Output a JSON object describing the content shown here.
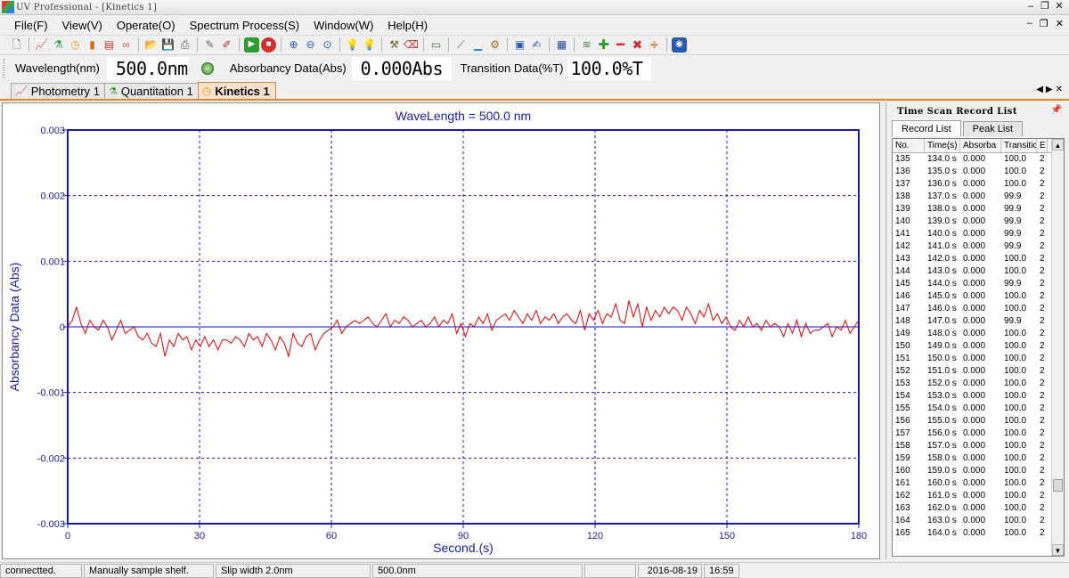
{
  "window": {
    "title": "UV Professional - [Kinetics 1]"
  },
  "menu": [
    "File(F)",
    "View(V)",
    "Operate(O)",
    "Spectrum Process(S)",
    "Window(W)",
    "Help(H)"
  ],
  "toolbar_icons": [
    "new-icon",
    "spectrum-icon",
    "flask-icon",
    "clock-icon",
    "tube-icon",
    "bar-chart-icon",
    "link-icon",
    "open-folder-icon",
    "save-icon",
    "print-icon",
    "pen-icon",
    "eraser-icon",
    "start-icon",
    "stop-icon",
    "zoom-in-icon",
    "zoom-out-icon",
    "zoom-reset-icon",
    "lamp-on-icon",
    "lamp-off-icon",
    "tools-icon",
    "delete-record-icon",
    "window-icon",
    "axis-icon",
    "baseline-icon",
    "settings-icon",
    "scan-window-icon",
    "edit-icon",
    "grid-icon",
    "layers-icon",
    "add-icon",
    "minus-icon",
    "multiply-icon",
    "divide-icon",
    "circle-icon"
  ],
  "readout": {
    "wavelength_label": "Wavelength(nm)",
    "wavelength_value": "500.0nm",
    "absorbance_label": "Absorbancy Data(Abs)",
    "absorbance_value": "0.000Abs",
    "transition_label": "Transition Data(%T)",
    "transition_value": "100.0%T"
  },
  "doc_tabs": [
    {
      "label": "Photometry 1",
      "icon": "spectrum-icon",
      "active": false
    },
    {
      "label": "Quantitation 1",
      "icon": "flask-icon",
      "active": false
    },
    {
      "label": "Kinetics 1",
      "icon": "clock-icon",
      "active": true
    }
  ],
  "chart_data": {
    "type": "line",
    "title": "WaveLength = 500.0 nm",
    "xlabel": "Second.(s)",
    "ylabel": "Absorbancy Data (Abs)",
    "xlim": [
      0,
      180
    ],
    "ylim": [
      -0.003,
      0.003
    ],
    "xticks": [
      0,
      30,
      60,
      90,
      120,
      150,
      180
    ],
    "yticks": [
      0.003,
      0.002,
      0.001,
      0,
      -0.001,
      -0.002,
      -0.003
    ],
    "ytick_labels": [
      "0.003",
      "0.002",
      "0.001",
      "0",
      "-0.001",
      "-0.002",
      "-0.003"
    ],
    "grid": true,
    "colors": {
      "axis": "#1a1aa8",
      "line": "#e00000",
      "zero": "#3a3ad0"
    },
    "series": [
      {
        "values": [
          0.0,
          0.0001,
          0.0003,
          5e-05,
          -0.0001,
          0.0001,
          0.0,
          -5e-05,
          0.0001,
          0.0,
          -0.0002,
          -5e-05,
          0.0001,
          -0.0001,
          -5e-05,
          0.0,
          -0.00015,
          -0.0002,
          -0.0001,
          -0.00025,
          -0.0003,
          -0.0001,
          -0.00045,
          -0.0002,
          -0.0003,
          -0.0001,
          -0.0002,
          -0.00015,
          -0.00035,
          -0.0002,
          -0.0003,
          -0.00015,
          -0.0003,
          -0.0002,
          -0.00035,
          -0.0002,
          -0.0002,
          -0.00025,
          -0.00015,
          -0.0002,
          -0.0003,
          -0.0001,
          -0.0002,
          -0.00015,
          -0.0003,
          -0.0001,
          -0.0002,
          -0.00035,
          -0.00015,
          -0.00025,
          -0.00045,
          -0.0001,
          -0.00025,
          -0.0003,
          -0.00015,
          -0.0001,
          -0.00035,
          -0.0002,
          -0.0001,
          -5e-05,
          0.0,
          0.0001,
          -0.0001,
          0.0,
          5e-05,
          0.0001,
          5e-05,
          0.0001,
          0.00015,
          5e-05,
          0.0,
          0.0001,
          0.0002,
          0.0,
          0.0001,
          5e-05,
          0.00015,
          0.0001,
          0.0,
          5e-05,
          0.0001,
          0.0,
          5e-05,
          0.00015,
          0.0,
          0.0001,
          5e-05,
          0.0002,
          -0.0001,
          5e-05,
          -0.00015,
          5e-05,
          0.0,
          0.00015,
          5e-05,
          0.0002,
          -5e-05,
          0.0001,
          0.00015,
          0.0002,
          0.0001,
          0.00025,
          0.00015,
          5e-05,
          0.0002,
          0.0001,
          0.00025,
          5e-05,
          0.00015,
          0.0001,
          0.0002,
          5e-05,
          0.00015,
          0.0002,
          0.0001,
          5e-05,
          0.00025,
          -5e-05,
          0.0002,
          0.0001,
          0.00025,
          5e-05,
          0.0002,
          0.00015,
          0.00035,
          0.0001,
          5e-05,
          0.0004,
          0.00015,
          0.00035,
          0.0,
          0.0003,
          0.0001,
          0.00025,
          0.00015,
          0.0003,
          0.0002,
          0.0003,
          0.00025,
          0.0001,
          0.0003,
          0.0002,
          5e-05,
          0.00025,
          0.00015,
          0.00035,
          0.0001,
          0.0002,
          5e-05,
          0.00015,
          0.0,
          -5e-05,
          0.0001,
          0.0,
          0.00015,
          0.0,
          5e-05,
          -5e-05,
          0.0001,
          0.0,
          5e-05,
          0.0,
          -0.00015,
          5e-05,
          -0.0001,
          0.0001,
          -0.00015,
          5e-05,
          -0.0001,
          -5e-05,
          -5e-05,
          0.0,
          5e-05,
          -0.00015,
          0.0,
          -5e-05,
          0.0001,
          -0.0001,
          0.0,
          0.0001
        ]
      }
    ]
  },
  "right_panel": {
    "title": "Time Scan Record List",
    "tabs": [
      "Record List",
      "Peak List"
    ],
    "columns": [
      "No.",
      "Time(s)",
      "Absorba",
      "Transitic",
      "E"
    ],
    "rows": [
      [
        "135",
        "134.0 s",
        "0.000",
        "100.0",
        "2"
      ],
      [
        "136",
        "135.0 s",
        "0.000",
        "100.0",
        "2"
      ],
      [
        "137",
        "136.0 s",
        "0.000",
        "100.0",
        "2"
      ],
      [
        "138",
        "137.0 s",
        "0.000",
        "99.9",
        "2"
      ],
      [
        "139",
        "138.0 s",
        "0.000",
        "99.9",
        "2"
      ],
      [
        "140",
        "139.0 s",
        "0.000",
        "99.9",
        "2"
      ],
      [
        "141",
        "140.0 s",
        "0.000",
        "99.9",
        "2"
      ],
      [
        "142",
        "141.0 s",
        "0.000",
        "99.9",
        "2"
      ],
      [
        "143",
        "142.0 s",
        "0.000",
        "100.0",
        "2"
      ],
      [
        "144",
        "143.0 s",
        "0.000",
        "100.0",
        "2"
      ],
      [
        "145",
        "144.0 s",
        "0.000",
        "99.9",
        "2"
      ],
      [
        "146",
        "145.0 s",
        "0.000",
        "100.0",
        "2"
      ],
      [
        "147",
        "146.0 s",
        "0.000",
        "100.0",
        "2"
      ],
      [
        "148",
        "147.0 s",
        "0.000",
        "99.9",
        "2"
      ],
      [
        "149",
        "148.0 s",
        "0.000",
        "100.0",
        "2"
      ],
      [
        "150",
        "149.0 s",
        "0.000",
        "100.0",
        "2"
      ],
      [
        "151",
        "150.0 s",
        "0.000",
        "100.0",
        "2"
      ],
      [
        "152",
        "151.0 s",
        "0.000",
        "100.0",
        "2"
      ],
      [
        "153",
        "152.0 s",
        "0.000",
        "100.0",
        "2"
      ],
      [
        "154",
        "153.0 s",
        "0.000",
        "100.0",
        "2"
      ],
      [
        "155",
        "154.0 s",
        "0.000",
        "100.0",
        "2"
      ],
      [
        "156",
        "155.0 s",
        "0.000",
        "100.0",
        "2"
      ],
      [
        "157",
        "156.0 s",
        "0.000",
        "100.0",
        "2"
      ],
      [
        "158",
        "157.0 s",
        "0.000",
        "100.0",
        "2"
      ],
      [
        "159",
        "158.0 s",
        "0.000",
        "100.0",
        "2"
      ],
      [
        "160",
        "159.0 s",
        "0.000",
        "100.0",
        "2"
      ],
      [
        "161",
        "160.0 s",
        "0.000",
        "100.0",
        "2"
      ],
      [
        "162",
        "161.0 s",
        "0.000",
        "100.0",
        "2"
      ],
      [
        "163",
        "162.0 s",
        "0.000",
        "100.0",
        "2"
      ],
      [
        "164",
        "163.0 s",
        "0.000",
        "100.0",
        "2"
      ],
      [
        "165",
        "164.0 s",
        "0.000",
        "100.0",
        "2"
      ]
    ]
  },
  "status": {
    "connection": "connectted.",
    "sample": "Manually sample shelf.",
    "slit": "Slip width 2.0nm",
    "wavelength": "500.0nm",
    "empty": "",
    "date": "2016-08-19",
    "time": "16:59"
  }
}
